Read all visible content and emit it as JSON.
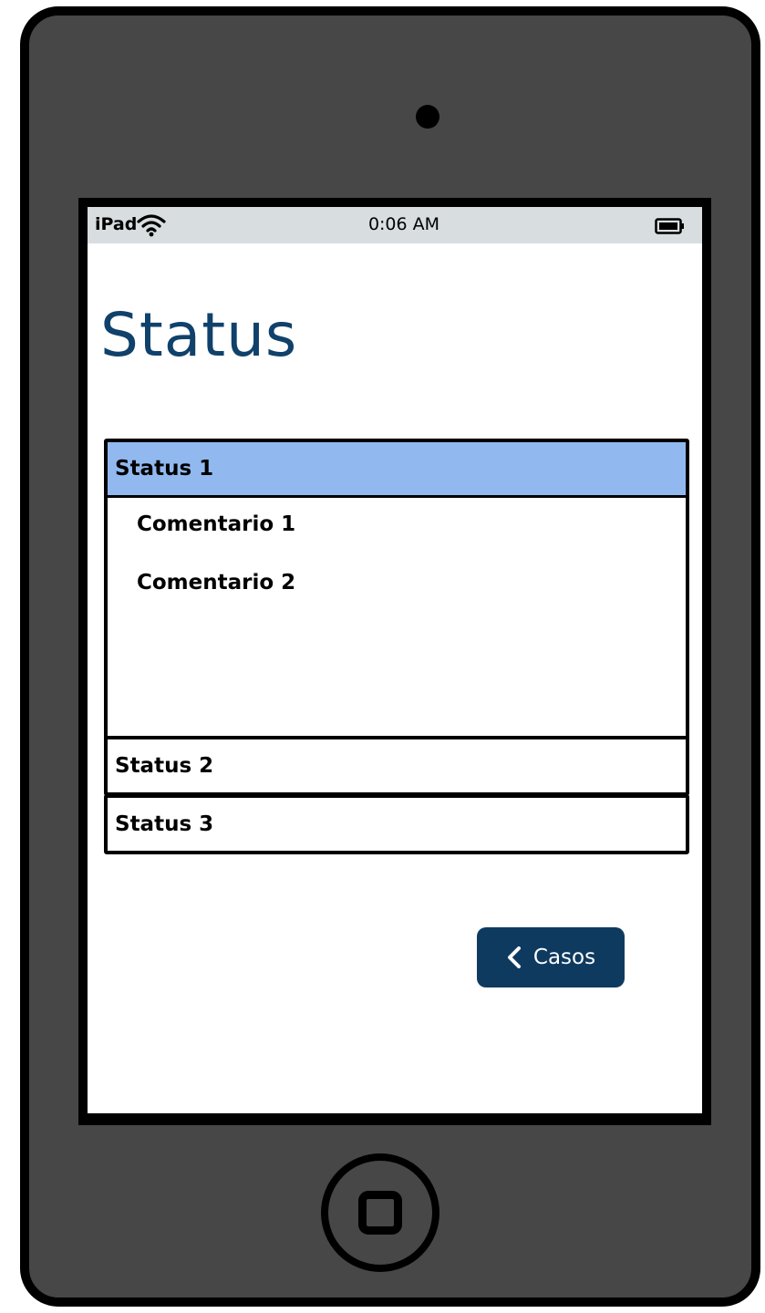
{
  "statusbar": {
    "carrier": "iPad",
    "time": "0:06 AM",
    "wifi_icon": "wifi-icon",
    "battery_icon": "battery-icon"
  },
  "page": {
    "title": "Status"
  },
  "accordion": {
    "items": [
      {
        "label": "Status 1",
        "expanded": true,
        "comments": [
          "Comentario 1",
          "Comentario 2"
        ]
      },
      {
        "label": "Status 2",
        "expanded": false
      },
      {
        "label": "Status 3",
        "expanded": false
      }
    ]
  },
  "back_button": {
    "label": "Casos",
    "icon": "chevron-left-icon"
  },
  "colors": {
    "device_body": "#474747",
    "title": "#10416b",
    "active_header": "#91b9ef",
    "button": "#0f3a60",
    "statusbar": "#d8dde0"
  }
}
